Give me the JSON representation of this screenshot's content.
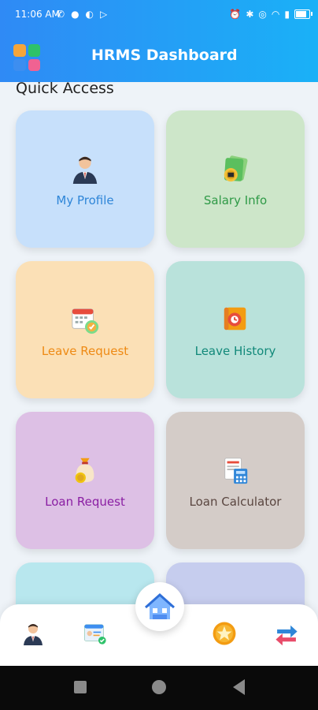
{
  "status_bar": {
    "time": "11:06 AM"
  },
  "app_bar": {
    "title": "HRMS Dashboard"
  },
  "section": {
    "title": "Quick Access"
  },
  "tiles": [
    {
      "label": "My Profile",
      "icon": "user-icon",
      "bg": "#c7e0fb",
      "color": "#2f86d8"
    },
    {
      "label": "Salary Info",
      "icon": "money-icon",
      "bg": "#cde6c9",
      "color": "#2f9a47"
    },
    {
      "label": "Leave Request",
      "icon": "calendar-icon",
      "bg": "#fbe0b6",
      "color": "#ee8a14"
    },
    {
      "label": "Leave History",
      "icon": "scroll-icon",
      "bg": "#b9e2db",
      "color": "#12897a"
    },
    {
      "label": "Loan Request",
      "icon": "money-bag-icon",
      "bg": "#ddc0e5",
      "color": "#8a1ea3"
    },
    {
      "label": "Loan Calculator",
      "icon": "calculator-icon",
      "bg": "#d4ccc8",
      "color": "#5a4640"
    }
  ],
  "partial_tiles": [
    {
      "bg": "#b8e7ee"
    },
    {
      "bg": "#c6cdee"
    }
  ],
  "bottom_nav": {
    "items": [
      "profile-icon",
      "id-card-icon",
      "home-icon",
      "star-icon",
      "swap-icon"
    ]
  }
}
